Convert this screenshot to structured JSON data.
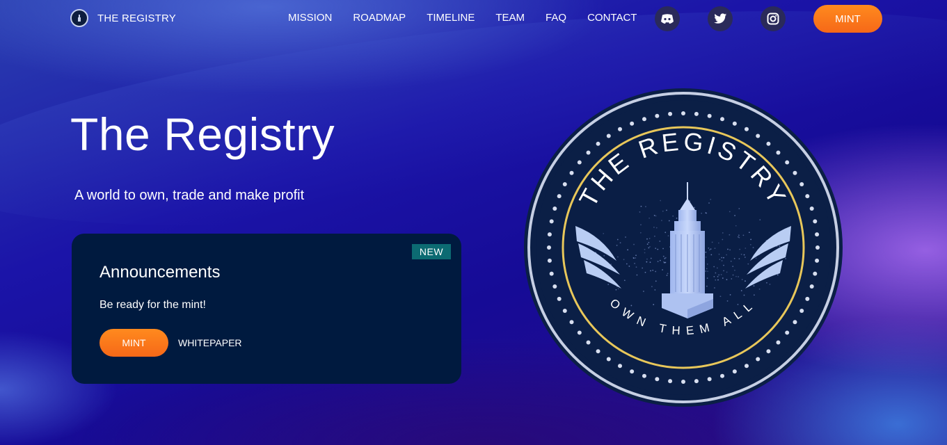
{
  "brand": {
    "name": "THE REGISTRY",
    "logo_icon": "registry-seal-icon"
  },
  "nav": {
    "items": [
      {
        "label": "MISSION"
      },
      {
        "label": "ROADMAP"
      },
      {
        "label": "TIMELINE"
      },
      {
        "label": "TEAM"
      },
      {
        "label": "FAQ"
      },
      {
        "label": "CONTACT"
      }
    ],
    "social": [
      {
        "icon": "discord-icon"
      },
      {
        "icon": "twitter-icon"
      },
      {
        "icon": "instagram-icon"
      }
    ],
    "mint_label": "MINT"
  },
  "hero": {
    "title": "The Registry",
    "subtitle": "A world to own, trade and make profit"
  },
  "announcement": {
    "badge": "NEW",
    "title": "Announcements",
    "text": "Be ready for the mint!",
    "mint_label": "MINT",
    "whitepaper_label": "WHITEPAPER"
  },
  "emblem": {
    "top_text": "THE REGISTRY",
    "bottom_text": "OWN THEM ALL"
  },
  "colors": {
    "accent_orange": "#f97316",
    "card_bg": "#001a3f",
    "badge_bg": "#0c6a72",
    "emblem_ring_gold": "#e8c75a",
    "emblem_bg": "#0b1f46"
  }
}
